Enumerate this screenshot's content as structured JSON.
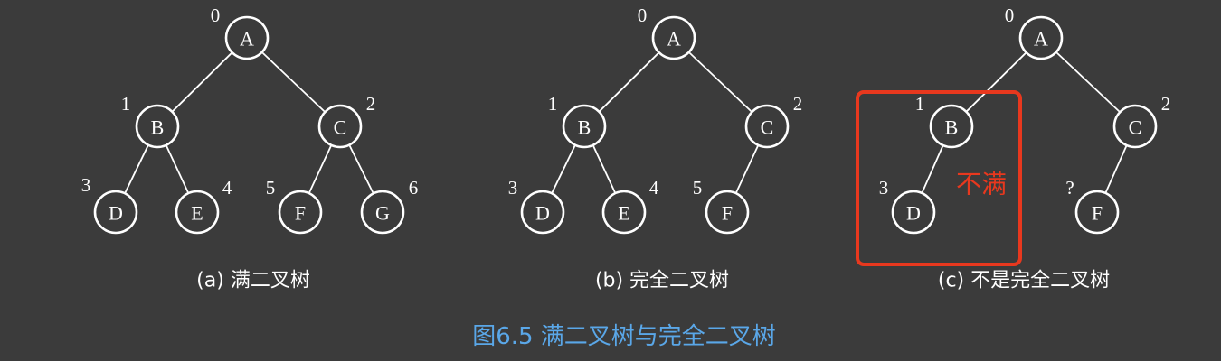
{
  "trees": [
    {
      "id": "a",
      "caption": "(a) 满二叉树",
      "nodes": [
        {
          "id": "A",
          "label": "A",
          "index": "0"
        },
        {
          "id": "B",
          "label": "B",
          "index": "1"
        },
        {
          "id": "C",
          "label": "C",
          "index": "2"
        },
        {
          "id": "D",
          "label": "D",
          "index": "3"
        },
        {
          "id": "E",
          "label": "E",
          "index": "4"
        },
        {
          "id": "F",
          "label": "F",
          "index": "5"
        },
        {
          "id": "G",
          "label": "G",
          "index": "6"
        }
      ],
      "edges": [
        [
          "A",
          "B"
        ],
        [
          "A",
          "C"
        ],
        [
          "B",
          "D"
        ],
        [
          "B",
          "E"
        ],
        [
          "C",
          "F"
        ],
        [
          "C",
          "G"
        ]
      ]
    },
    {
      "id": "b",
      "caption": "(b) 完全二叉树",
      "nodes": [
        {
          "id": "A",
          "label": "A",
          "index": "0"
        },
        {
          "id": "B",
          "label": "B",
          "index": "1"
        },
        {
          "id": "C",
          "label": "C",
          "index": "2"
        },
        {
          "id": "D",
          "label": "D",
          "index": "3"
        },
        {
          "id": "E",
          "label": "E",
          "index": "4"
        },
        {
          "id": "F",
          "label": "F",
          "index": "5"
        }
      ],
      "edges": [
        [
          "A",
          "B"
        ],
        [
          "A",
          "C"
        ],
        [
          "B",
          "D"
        ],
        [
          "B",
          "E"
        ],
        [
          "C",
          "F"
        ]
      ]
    },
    {
      "id": "c",
      "caption": "(c) 不是完全二叉树",
      "nodes": [
        {
          "id": "A",
          "label": "A",
          "index": "0"
        },
        {
          "id": "B",
          "label": "B",
          "index": "1"
        },
        {
          "id": "C",
          "label": "C",
          "index": "2"
        },
        {
          "id": "D",
          "label": "D",
          "index": "3"
        },
        {
          "id": "F",
          "label": "F",
          "index": "?"
        }
      ],
      "edges": [
        [
          "A",
          "B"
        ],
        [
          "A",
          "C"
        ],
        [
          "B",
          "D"
        ],
        [
          "C",
          "F"
        ]
      ]
    }
  ],
  "highlight": {
    "label": "不满",
    "color": "#e8381e"
  },
  "figure_caption": "图6.5 满二叉树与完全二叉树",
  "colors": {
    "background": "#3b3b3b",
    "stroke": "#ffffff",
    "caption": "#5aa7e8"
  }
}
